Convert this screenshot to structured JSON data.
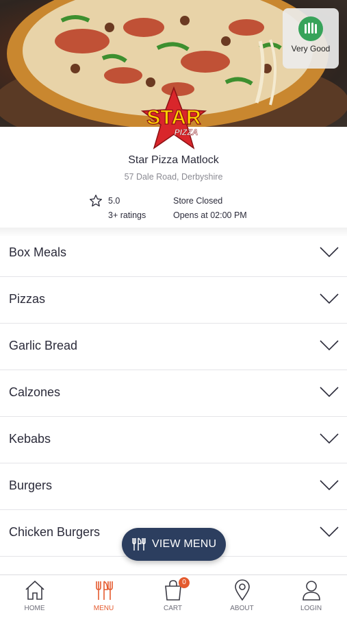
{
  "hero": {
    "hygiene_rating_label": "Very Good"
  },
  "logo": {
    "text_main": "STAR",
    "text_sub": "PIZZA"
  },
  "store": {
    "name": "Star Pizza Matlock",
    "address": "57 Dale Road, Derbyshire",
    "rating_value": "5.0",
    "rating_count": "3+ ratings",
    "status": "Store Closed",
    "opens_at": "Opens at 02:00 PM"
  },
  "categories": [
    {
      "label": "Box Meals"
    },
    {
      "label": "Pizzas"
    },
    {
      "label": "Garlic Bread"
    },
    {
      "label": "Calzones"
    },
    {
      "label": "Kebabs"
    },
    {
      "label": "Burgers"
    },
    {
      "label": "Chicken Burgers"
    }
  ],
  "view_menu": {
    "label": "VIEW MENU"
  },
  "nav": {
    "items": [
      {
        "label": "HOME",
        "icon": "home-icon"
      },
      {
        "label": "MENU",
        "icon": "cutlery-icon"
      },
      {
        "label": "CART",
        "icon": "bag-icon",
        "badge": "0"
      },
      {
        "label": "ABOUT",
        "icon": "location-pin-icon"
      },
      {
        "label": "LOGIN",
        "icon": "user-icon"
      }
    ]
  },
  "colors": {
    "accent": "#e45a2e",
    "button": "#2c3e5f",
    "hygiene": "#37a35a"
  }
}
